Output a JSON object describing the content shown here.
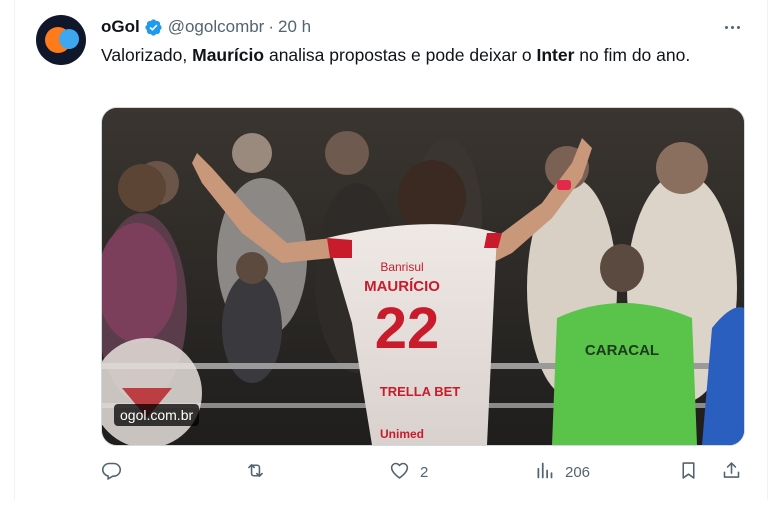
{
  "tweet": {
    "account_name": "oGol",
    "handle": "@ogolcombr",
    "separator": "·",
    "time": "20 h",
    "text_parts": {
      "p1": "Valorizado, ",
      "p2": "Maurício",
      "p3": " analisa propostas e pode deixar o ",
      "p4": "Inter",
      "p5": " no fim do ano."
    },
    "media": {
      "source_badge": "ogol.com.br",
      "jersey_name": "MAURÍCIO",
      "jersey_number": "22",
      "jersey_sponsor_top": "Banrisul",
      "jersey_sponsor_bottom": "TRELLA BET",
      "jersey_hem": "Unimed",
      "vest_text": "CARACAL"
    },
    "actions": {
      "reply_count": "",
      "retweet_count": "",
      "like_count": "2",
      "views_count": "206"
    }
  },
  "icons": {
    "verified": "verified-badge-icon",
    "more": "more-dots-icon",
    "reply": "reply-icon",
    "retweet": "retweet-icon",
    "like": "heart-icon",
    "views": "views-icon",
    "bookmark": "bookmark-icon",
    "share": "share-icon"
  },
  "colors": {
    "accent": "#1d9bf0",
    "text": "#0f1419",
    "muted": "#536471"
  }
}
